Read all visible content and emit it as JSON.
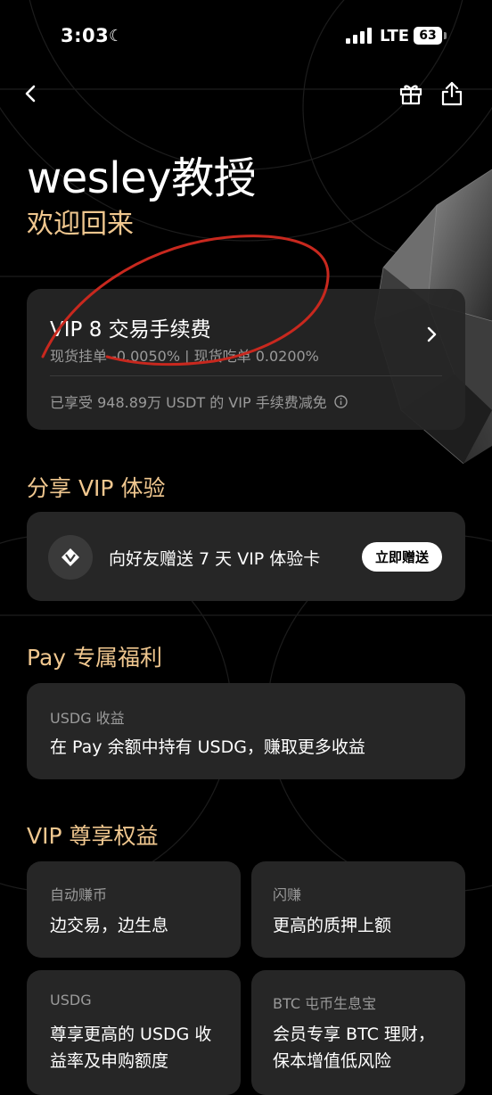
{
  "status": {
    "time": "3:03",
    "network": "LTE",
    "battery": "63"
  },
  "nav": {
    "back_icon": "chevron-left-icon",
    "gift_icon": "gift-icon",
    "share_icon": "share-icon"
  },
  "greeting": {
    "name": "wesley教授",
    "subtitle": "欢迎回来"
  },
  "vip_card": {
    "title": "VIP 8 交易手续费",
    "fee_rates": "现货挂单 -0.0050% | 现货吃单 0.0200%",
    "waiver": "已享受 948.89万 USDT 的 VIP 手续费减免"
  },
  "share": {
    "section_title": "分享 VIP 体验",
    "text": "向好友赠送 7 天 VIP 体验卡",
    "button": "立即赠送"
  },
  "pay": {
    "section_title": "Pay 专属福利",
    "label": "USDG 收益",
    "text": "在 Pay 余额中持有 USDG，赚取更多收益"
  },
  "benefits": {
    "section_title": "VIP 尊享权益",
    "items": [
      {
        "label": "自动赚币",
        "text": "边交易，边生息"
      },
      {
        "label": "闪赚",
        "text": "更高的质押上额"
      },
      {
        "label": "USDG",
        "text": "尊享更高的 USDG 收益率及申购额度"
      },
      {
        "label": "BTC 屯币生息宝",
        "text": "会员专享 BTC 理财，保本增值低风险"
      }
    ]
  },
  "colors": {
    "background": "#000000",
    "card": "#262626",
    "accent_gold": "#f0c78f",
    "annotation_red": "#c8281e"
  }
}
